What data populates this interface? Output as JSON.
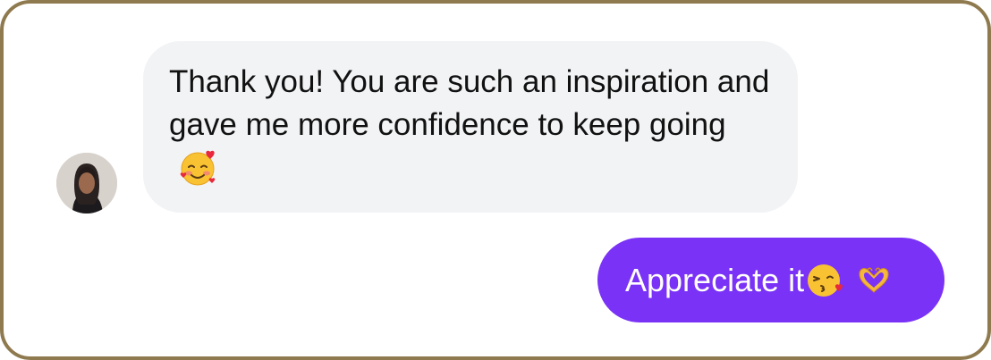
{
  "messages": {
    "incoming": {
      "text": "Thank you! You are such an inspiration and gave me more confidence to keep going",
      "emoji": "smiling-face-with-hearts"
    },
    "outgoing": {
      "text": "Appreciate it",
      "emojis": [
        "face-blowing-a-kiss",
        "heart-hands"
      ]
    }
  },
  "colors": {
    "frame_border": "#8f7a4f",
    "incoming_bubble": "#f2f3f5",
    "outgoing_bubble": "#7a32f6"
  }
}
